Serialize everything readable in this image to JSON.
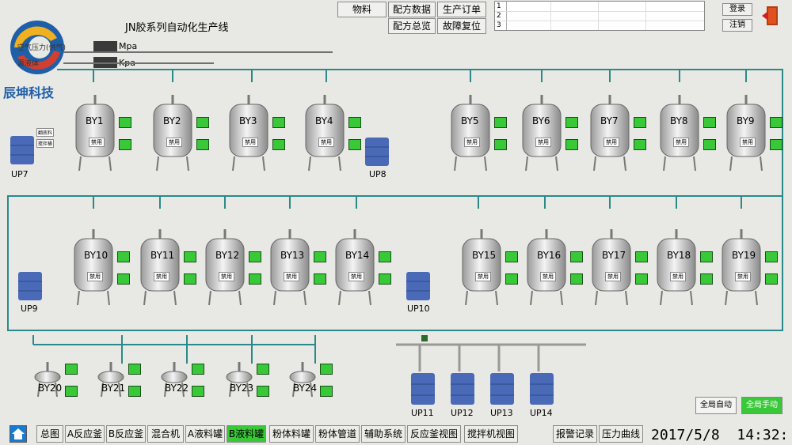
{
  "header": {
    "title": "JN胶系列自动化生产线",
    "logo_text": "辰坤科技",
    "gauge_units": [
      "Mpa",
      "Kpa"
    ],
    "gauge_labels": [
      "空气压力(供气)",
      "源液体"
    ],
    "top_buttons": [
      "物料",
      "配方数据",
      "生产订单",
      "配方总览",
      "故障复位"
    ],
    "order_rows": [
      "1",
      "2",
      "3"
    ],
    "login": "登录",
    "logout": "注销"
  },
  "tanks_row1": [
    "BY1",
    "BY2",
    "BY3",
    "BY4",
    "BY5",
    "BY6",
    "BY7",
    "BY8",
    "BY9"
  ],
  "tanks_row2": [
    "BY10",
    "BY11",
    "BY12",
    "BY13",
    "BY14",
    "BY15",
    "BY16",
    "BY17",
    "BY18",
    "BY19"
  ],
  "tanks_row3": [
    "BY20",
    "BY21",
    "BY22",
    "BY23",
    "BY24"
  ],
  "tank_disabled_label": "禁用",
  "up_units": [
    "UP7",
    "UP8",
    "UP9",
    "UP10"
  ],
  "up_units_bottom": [
    "UP11",
    "UP12",
    "UP13",
    "UP14"
  ],
  "small_labels": [
    "翻底料",
    "搅拌桶"
  ],
  "mode_buttons": {
    "auto": "全局自动",
    "manual": "全局手动"
  },
  "bottom_nav": [
    "总图",
    "A反应釜",
    "B反应釜",
    "混合机",
    "A液料罐",
    "B液料罐",
    "粉体料罐",
    "粉体管道",
    "辅助系统",
    "反应釜视图",
    "搅拌机视图",
    "报警记录",
    "压力曲线"
  ],
  "datetime": "2017/5/8  14:32:",
  "colors": {
    "pipe": "#2a8a8a",
    "active": "#38c838",
    "gauge": "#3a3a3a"
  }
}
